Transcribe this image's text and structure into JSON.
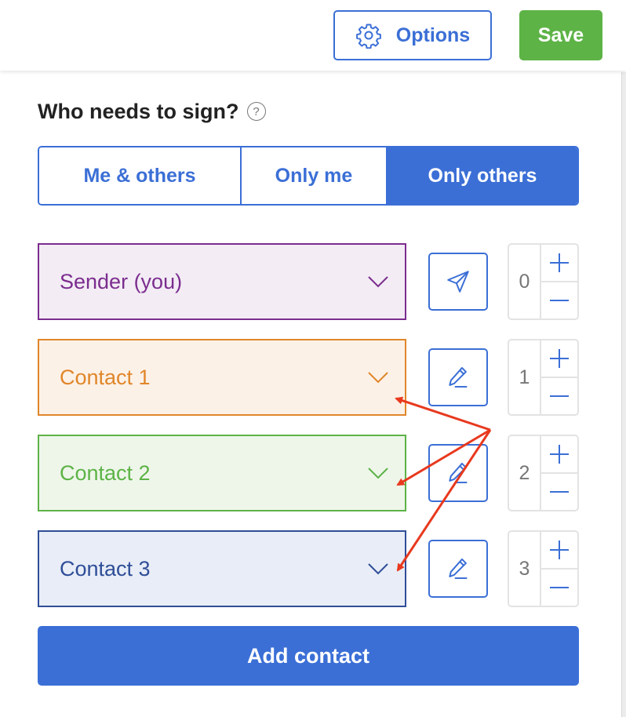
{
  "toolbar": {
    "options_label": "Options",
    "options_icon": "gear-icon",
    "save_label": "Save"
  },
  "signers": {
    "question": "Who needs to sign?",
    "help_glyph": "?",
    "modes": [
      {
        "label": "Me & others",
        "active": false
      },
      {
        "label": "Only me",
        "active": false
      },
      {
        "label": "Only others",
        "active": true
      }
    ]
  },
  "recipients": [
    {
      "name": "Sender (you)",
      "color": "#7b2d8e",
      "bg": "#f3ecf5",
      "action_icon": "send-icon",
      "order": "0"
    },
    {
      "name": "Contact 1",
      "color": "#e0862a",
      "bg": "#fcf1e7",
      "action_icon": "pencil-icon",
      "order": "1"
    },
    {
      "name": "Contact 2",
      "color": "#5db346",
      "bg": "#eef6ea",
      "action_icon": "pencil-icon",
      "order": "2"
    },
    {
      "name": "Contact 3",
      "color": "#2f4e98",
      "bg": "#e8edf7",
      "action_icon": "pencil-icon",
      "order": "3"
    }
  ],
  "add_contact_label": "Add contact",
  "annotation_arrow_color": "#e8391e",
  "colors": {
    "accent": "#3b6fd6",
    "save_green": "#5db346"
  }
}
